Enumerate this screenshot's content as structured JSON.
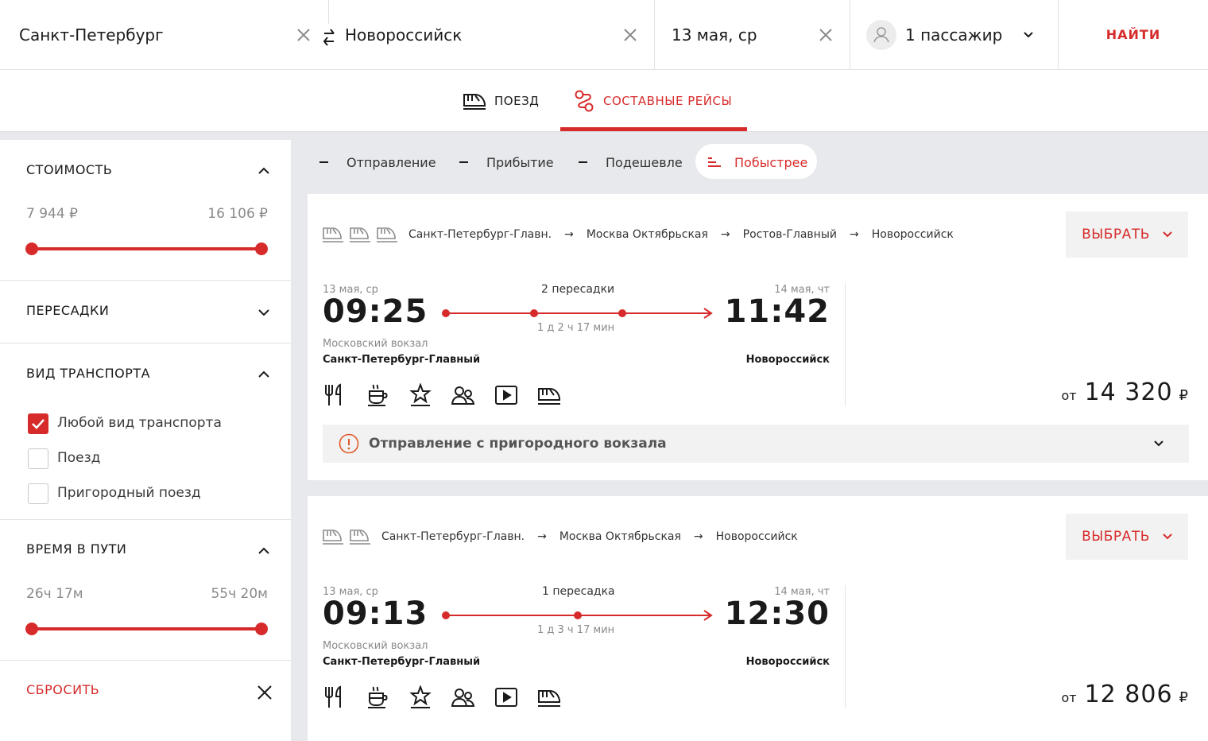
{
  "search": {
    "from": "Санкт-Петербург",
    "to": "Новороссийск",
    "date": "13 мая, ср",
    "passengers": "1 пассажир",
    "find": "НАЙТИ"
  },
  "tabs": [
    {
      "label": "ПОЕЗД",
      "active": false
    },
    {
      "label": "СОСТАВНЫЕ РЕЙСЫ",
      "active": true
    }
  ],
  "filters": {
    "price": {
      "title": "СТОИМОСТЬ",
      "min": "7 944 ₽",
      "max": "16 106 ₽"
    },
    "transfers": {
      "title": "ПЕРЕСАДКИ"
    },
    "transport": {
      "title": "ВИД ТРАНСПОРТА",
      "options": [
        {
          "label": "Любой вид транспорта",
          "checked": true
        },
        {
          "label": "Поезд",
          "checked": false
        },
        {
          "label": "Пригородный поезд",
          "checked": false
        }
      ]
    },
    "duration": {
      "title": "ВРЕМЯ В ПУТИ",
      "min": "26ч 17м",
      "max": "55ч 20м"
    },
    "reset": "СБРОСИТЬ"
  },
  "sort": [
    {
      "label": "Отправление",
      "active": false
    },
    {
      "label": "Прибытие",
      "active": false
    },
    {
      "label": "Подешевле",
      "active": false
    },
    {
      "label": "Побыстрее",
      "active": true
    }
  ],
  "results": [
    {
      "route": [
        "Санкт-Петербург-Главн.",
        "Москва Октябрьская",
        "Ростов-Главный",
        "Новороссийск"
      ],
      "select": "ВЫБРАТЬ",
      "dep_date": "13 мая, ср",
      "dep_time": "09:25",
      "arr_date": "14 мая, чт",
      "arr_time": "11:42",
      "transfers": "2 пересадки",
      "duration": "1 д 2 ч 17 мин",
      "dep_station_small": "Московский вокзал",
      "dep_station": "Санкт-Петербург-Главный",
      "arr_station": "Новороссийск",
      "price_from": "от",
      "price": "14 320",
      "currency": "₽",
      "notice": "Отправление с пригородного вокзала",
      "services": [
        "restaurant-icon",
        "coffee-icon",
        "star-icon",
        "people-icon",
        "video-icon",
        "train-icon"
      ]
    },
    {
      "route": [
        "Санкт-Петербург-Главн.",
        "Москва Октябрьская",
        "Новороссийск"
      ],
      "select": "ВЫБРАТЬ",
      "dep_date": "13 мая, ср",
      "dep_time": "09:13",
      "arr_date": "14 мая, чт",
      "arr_time": "12:30",
      "transfers": "1 пересадка",
      "duration": "1 д 3 ч 17 мин",
      "dep_station_small": "Московский вокзал",
      "dep_station": "Санкт-Петербург-Главный",
      "arr_station": "Новороссийск",
      "price_from": "от",
      "price": "12 806",
      "currency": "₽",
      "services": [
        "restaurant-icon",
        "coffee-icon",
        "star-icon",
        "people-icon",
        "video-icon",
        "train-icon"
      ]
    }
  ],
  "colors": {
    "accent": "#d72b2b",
    "page_bg": "#e8e9ec",
    "panel_bg": "#f2f2f2"
  }
}
